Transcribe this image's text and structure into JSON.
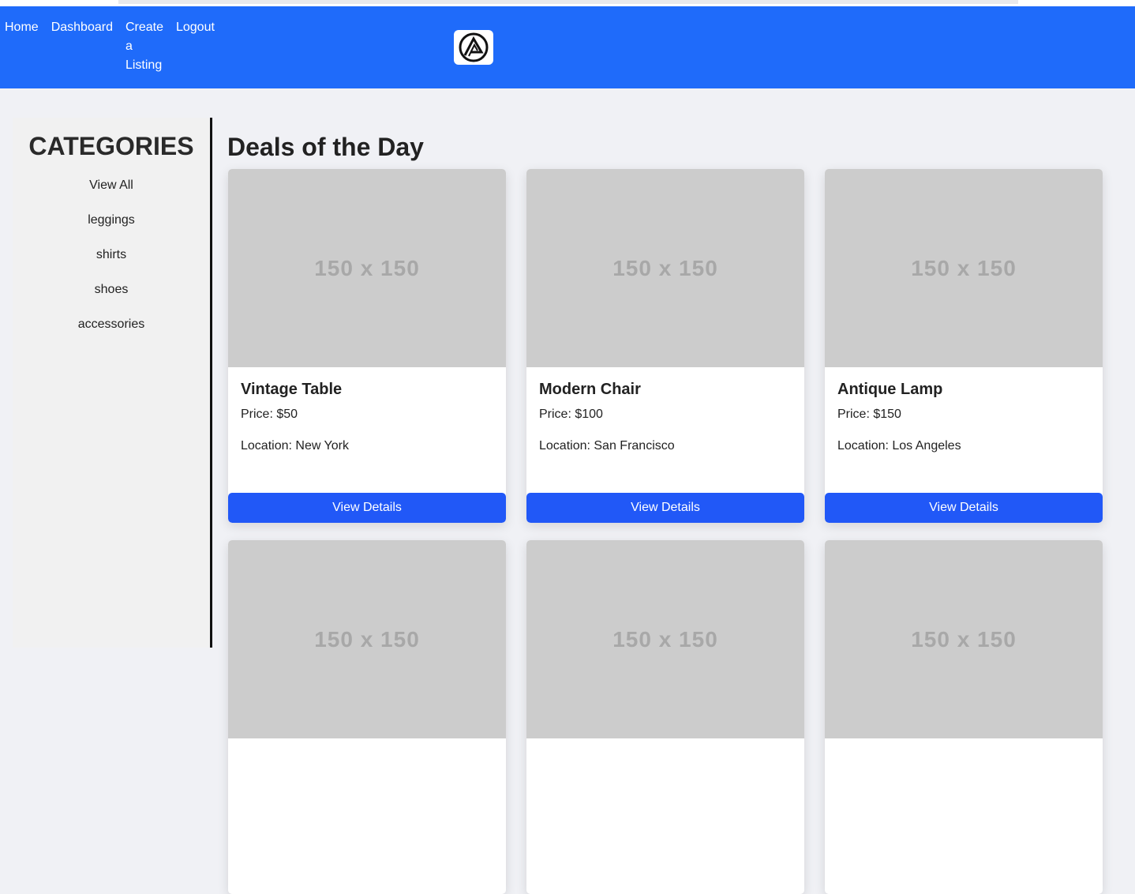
{
  "nav": {
    "links": [
      "Home",
      "Dashboard",
      "Create a Listing",
      "Logout"
    ],
    "logo_icon": "logo-icon"
  },
  "sidebar": {
    "title": "CATEGORIES",
    "items": [
      "View All",
      "leggings",
      "shirts",
      "shoes",
      "accessories"
    ]
  },
  "main": {
    "title": "Deals of the Day",
    "placeholder_text": "150 x 150",
    "button_label": "View Details",
    "listings": [
      {
        "title": "Vintage Table",
        "price": "Price: $50",
        "location": "Location: New York"
      },
      {
        "title": "Modern Chair",
        "price": "Price: $100",
        "location": "Location: San Francisco"
      },
      {
        "title": "Antique Lamp",
        "price": "Price: $150",
        "location": "Location: Los Angeles"
      }
    ]
  },
  "colors": {
    "navbar": "#1f6bfa",
    "button": "#2158f7",
    "page_bg": "#f0f1f5",
    "image_placeholder": "#cccccc"
  }
}
